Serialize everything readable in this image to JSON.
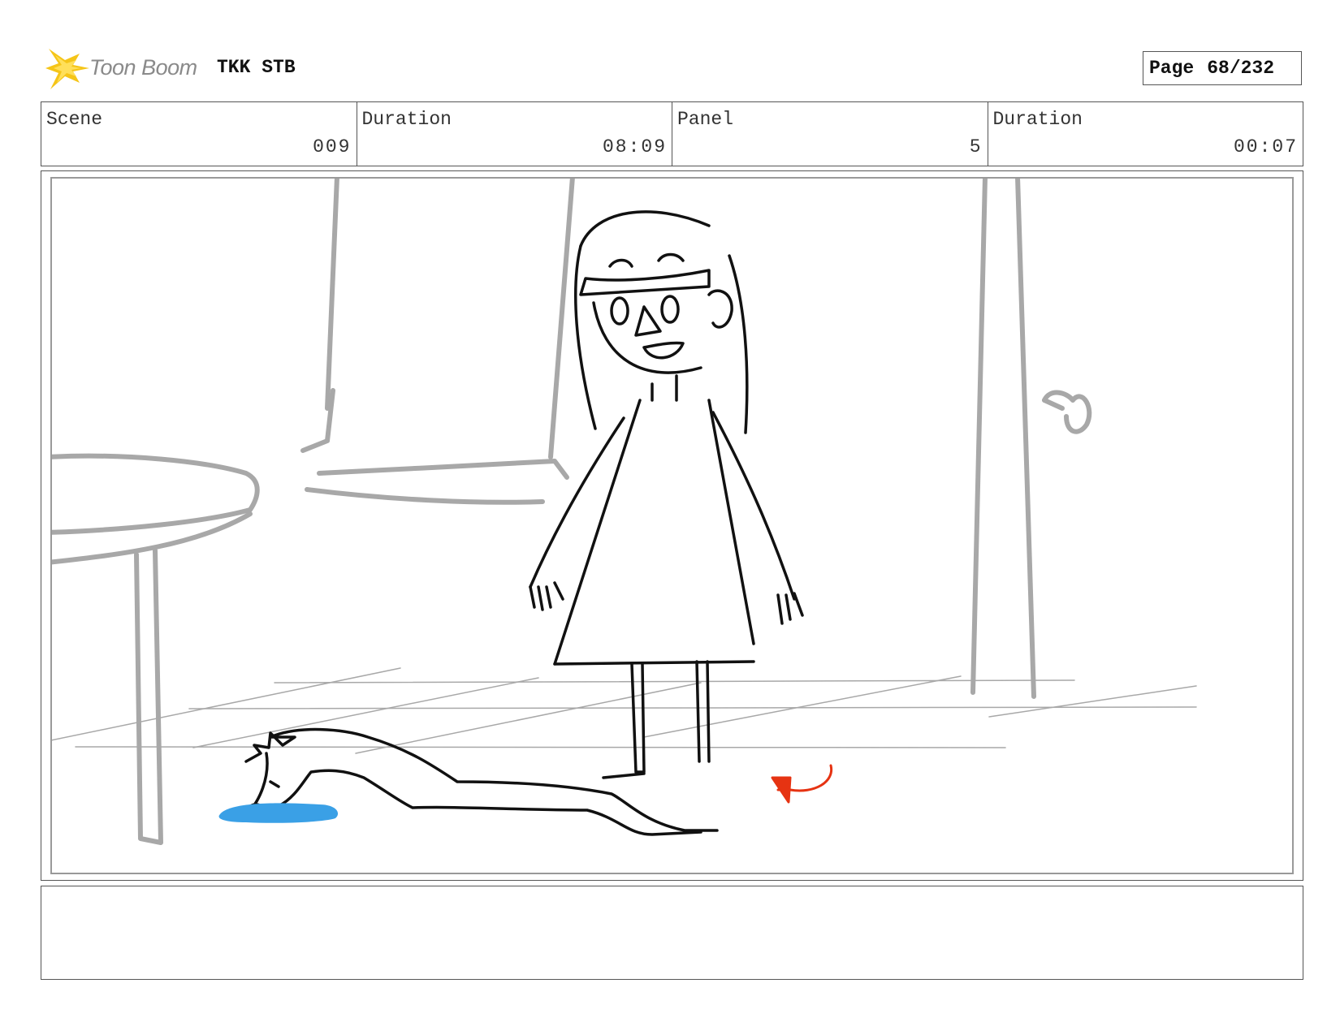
{
  "header": {
    "logo_text": "Toon Boom",
    "project_title": "TKK STB",
    "page_label": "Page",
    "page_number": "68/232"
  },
  "info": {
    "scene_label": "Scene",
    "scene_value": "009",
    "scene_duration_label": "Duration",
    "scene_duration_value": "08:09",
    "panel_label": "Panel",
    "panel_value": "5",
    "panel_duration_label": "Duration",
    "panel_duration_value": "00:07"
  },
  "colors": {
    "logo_star": "#f5c518",
    "puddle": "#3aa0e6",
    "arrow": "#e63312",
    "background_lines": "#a8a8a8",
    "character_lines": "#111111"
  },
  "notes": {
    "text": ""
  }
}
